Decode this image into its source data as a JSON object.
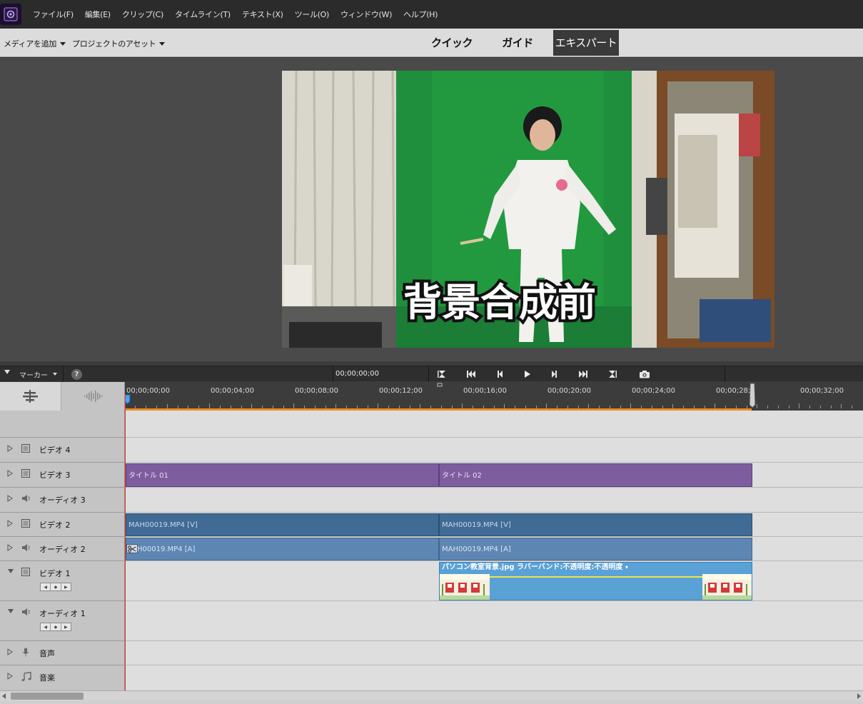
{
  "menubar": {
    "items": [
      "ファイル(F)",
      "編集(E)",
      "クリップ(C)",
      "タイムライン(T)",
      "テキスト(X)",
      "ツール(O)",
      "ウィンドウ(W)",
      "ヘルプ(H)"
    ]
  },
  "modebar": {
    "add_media": "メディアを追加",
    "project_assets": "プロジェクトのアセット",
    "tabs": [
      "クイック",
      "ガイド",
      "エキスパート"
    ],
    "active_tab": "エキスパート"
  },
  "monitor": {
    "overlay_text": "背景合成前"
  },
  "transport": {
    "marker_label": "マーカー",
    "timecode": "00;00;00;00"
  },
  "ruler": {
    "ticks": [
      "00;00;00;00",
      "00;00;04;00",
      "00;00;08;00",
      "00;00;12;00",
      "00;00;16;00",
      "00;00;20;00",
      "00;00;24;00",
      "00;00;28;0",
      "00;00;32;00"
    ]
  },
  "tracks": [
    {
      "name": "ビデオ 4",
      "kind": "video"
    },
    {
      "name": "ビデオ 3",
      "kind": "video"
    },
    {
      "name": "オーディオ 3",
      "kind": "audio"
    },
    {
      "name": "ビデオ 2",
      "kind": "video"
    },
    {
      "name": "オーディオ 2",
      "kind": "audio"
    },
    {
      "name": "ビデオ 1",
      "kind": "video"
    },
    {
      "name": "オーディオ 1",
      "kind": "audio"
    },
    {
      "name": "音声",
      "kind": "narration"
    },
    {
      "name": "音楽",
      "kind": "music"
    }
  ],
  "clips": {
    "title1": "タイトル 01",
    "title2": "タイトル 02",
    "video2_a": "MAH00019.MP4 [V]",
    "video2_b": "MAH00019.MP4 [V]",
    "audio2_a": "H00019.MP4 [A]",
    "audio2_b": "MAH00019.MP4 [A]",
    "video1_image": "パソコン教室背景.jpg ラバーバンド:不透明度:不透明度"
  },
  "colors": {
    "title_clip": "#7e5d9f",
    "video_clip": "#3f6b95",
    "audio_clip": "#5e86b3",
    "image_clip": "#5aa1d6",
    "playhead": "#e0392b",
    "work_area": "#f08a1c"
  }
}
